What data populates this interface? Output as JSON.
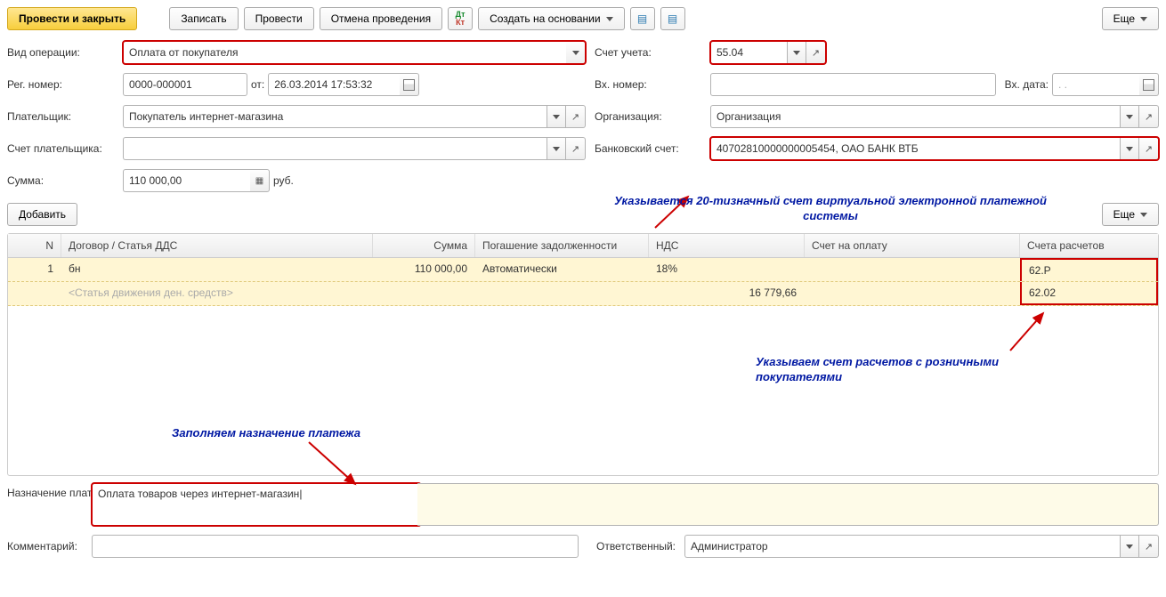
{
  "toolbar": {
    "post_close": "Провести и закрыть",
    "save": "Записать",
    "post": "Провести",
    "unpost": "Отмена проведения",
    "create_based": "Создать на основании",
    "more": "Еще"
  },
  "form": {
    "op_type_label": "Вид операции:",
    "op_type_value": "Оплата от покупателя",
    "account_label": "Счет учета:",
    "account_value": "55.04",
    "reg_num_label": "Рег. номер:",
    "reg_num_value": "0000-000001",
    "from_label": "от:",
    "date_value": "26.03.2014 17:53:32",
    "in_num_label": "Вх. номер:",
    "in_num_value": "",
    "in_date_label": "Вх. дата:",
    "in_date_value": ".   .",
    "payer_label": "Плательщик:",
    "payer_value": "Покупатель интернет-магазина",
    "org_label": "Организация:",
    "org_value": "Организация",
    "payer_acc_label": "Счет плательщика:",
    "payer_acc_value": "",
    "bank_acc_label": "Банковский счет:",
    "bank_acc_value": "40702810000000005454, ОАО БАНК ВТБ",
    "sum_label": "Сумма:",
    "sum_value": "110 000,00",
    "currency": "руб."
  },
  "table": {
    "add": "Добавить",
    "more": "Еще",
    "headers": {
      "n": "N",
      "dogovor": "Договор / Статья ДДС",
      "sum": "Сумма",
      "pog": "Погашение задолженности",
      "nds": "НДС",
      "schet": "Счет на оплату",
      "rasch": "Счета расчетов"
    },
    "rows": [
      {
        "n": "1",
        "dogovor": "бн",
        "dds": "<Статья движения ден. средств>",
        "sum": "110 000,00",
        "pog": "Автоматически",
        "nds_rate": "18%",
        "nds_sum": "16 779,66",
        "schet": "",
        "rasch1": "62.Р",
        "rasch2": "62.02"
      }
    ]
  },
  "annotations": {
    "bank": "Указывается 20-тизначный счет виртуальной электронной платежной системы",
    "rasch": "Указываем счет расчетов с розничными покупателями",
    "purpose": "Заполняем назначение платежа"
  },
  "footer": {
    "purpose_label": "Назначение платежа:",
    "purpose_value": "Оплата товаров через интернет-магазин",
    "comment_label": "Комментарий:",
    "comment_value": "",
    "resp_label": "Ответственный:",
    "resp_value": "Администратор"
  }
}
